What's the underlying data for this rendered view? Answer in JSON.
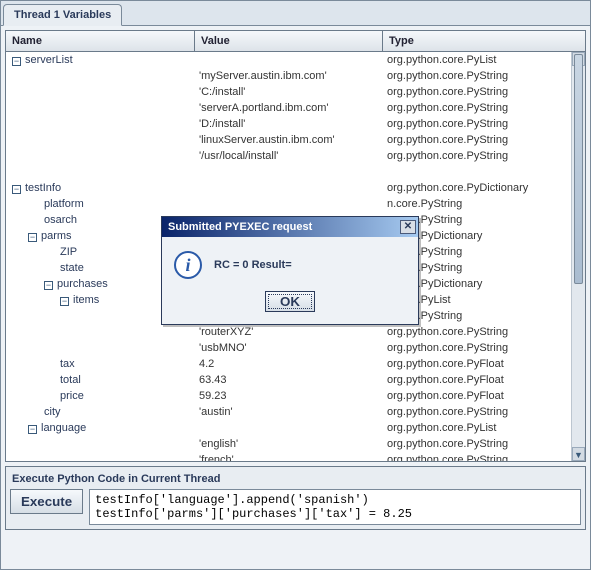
{
  "tab_title": "Thread 1 Variables",
  "headers": {
    "name": "Name",
    "value": "Value",
    "type": "Type"
  },
  "tree": [
    {
      "indent": 0,
      "toggle": "-",
      "label": "serverList",
      "value": "",
      "type": "org.python.core.PyList"
    },
    {
      "indent": 2,
      "toggle": "",
      "label": "",
      "value": "'myServer.austin.ibm.com'",
      "type": "org.python.core.PyString"
    },
    {
      "indent": 2,
      "toggle": "",
      "label": "",
      "value": "'C:/install'",
      "type": "org.python.core.PyString"
    },
    {
      "indent": 2,
      "toggle": "",
      "label": "",
      "value": "'serverA.portland.ibm.com'",
      "type": "org.python.core.PyString"
    },
    {
      "indent": 2,
      "toggle": "",
      "label": "",
      "value": "'D:/install'",
      "type": "org.python.core.PyString"
    },
    {
      "indent": 2,
      "toggle": "",
      "label": "",
      "value": "'linuxServer.austin.ibm.com'",
      "type": "org.python.core.PyString"
    },
    {
      "indent": 2,
      "toggle": "",
      "label": "",
      "value": "'/usr/local/install'",
      "type": "org.python.core.PyString"
    },
    {
      "indent": 2,
      "toggle": "",
      "label": "",
      "value": "",
      "type": ""
    },
    {
      "indent": 0,
      "toggle": "-",
      "label": "testInfo",
      "value": "",
      "type": "org.python.core.PyDictionary"
    },
    {
      "indent": 2,
      "toggle": "",
      "label": "platform",
      "value": "",
      "type": "n.core.PyString"
    },
    {
      "indent": 2,
      "toggle": "",
      "label": "osarch",
      "value": "",
      "type": "n.core.PyString"
    },
    {
      "indent": 1,
      "toggle": "-",
      "label": "parms",
      "value": "",
      "type": "n.core.PyDictionary"
    },
    {
      "indent": 3,
      "toggle": "",
      "label": "ZIP",
      "value": "",
      "type": "n.core.PyString"
    },
    {
      "indent": 3,
      "toggle": "",
      "label": "state",
      "value": "",
      "type": "n.core.PyString"
    },
    {
      "indent": 2,
      "toggle": "-",
      "label": "purchases",
      "value": "",
      "type": "n.core.PyDictionary"
    },
    {
      "indent": 3,
      "toggle": "-",
      "label": "items",
      "value": "",
      "type": "n.core.PyList"
    },
    {
      "indent": 5,
      "toggle": "",
      "label": "",
      "value": "",
      "type": "n.core.PyString"
    },
    {
      "indent": 5,
      "toggle": "",
      "label": "",
      "value": "'routerXYZ'",
      "type": "org.python.core.PyString"
    },
    {
      "indent": 5,
      "toggle": "",
      "label": "",
      "value": "'usbMNO'",
      "type": "org.python.core.PyString"
    },
    {
      "indent": 3,
      "toggle": "",
      "label": "tax",
      "value": "4.2",
      "type": "org.python.core.PyFloat"
    },
    {
      "indent": 3,
      "toggle": "",
      "label": "total",
      "value": "63.43",
      "type": "org.python.core.PyFloat"
    },
    {
      "indent": 3,
      "toggle": "",
      "label": "price",
      "value": "59.23",
      "type": "org.python.core.PyFloat"
    },
    {
      "indent": 2,
      "toggle": "",
      "label": "city",
      "value": "'austin'",
      "type": "org.python.core.PyString"
    },
    {
      "indent": 1,
      "toggle": "-",
      "label": "language",
      "value": "",
      "type": "org.python.core.PyList"
    },
    {
      "indent": 3,
      "toggle": "",
      "label": "",
      "value": "'english'",
      "type": "org.python.core.PyString"
    },
    {
      "indent": 3,
      "toggle": "",
      "label": "",
      "value": "'french'",
      "type": "org.python.core.PyString"
    }
  ],
  "exec_panel": {
    "title": "Execute Python Code in Current Thread",
    "button": "Execute",
    "code": "testInfo['language'].append('spanish')\ntestInfo['parms']['purchases']['tax'] = 8.25"
  },
  "dialog": {
    "title": "Submitted PYEXEC request",
    "message": "RC = 0 Result=",
    "ok": "OK",
    "close_glyph": "✕",
    "info_glyph": "i"
  }
}
